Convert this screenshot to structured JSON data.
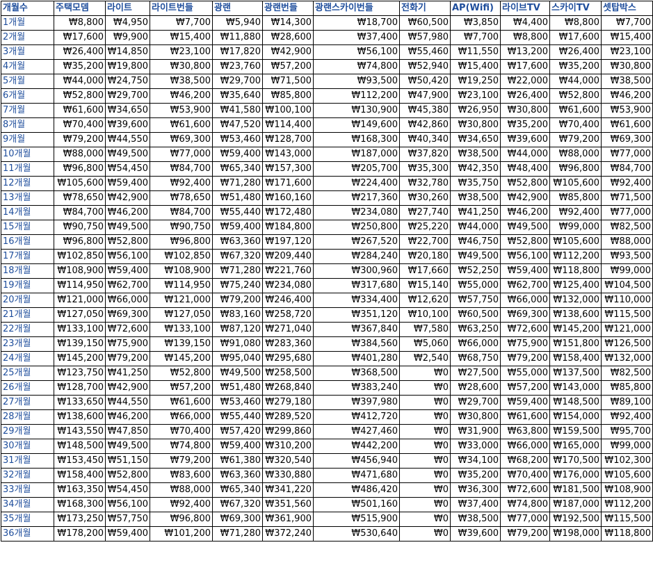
{
  "headers": [
    "개월수",
    "주택모뎀",
    "라이트",
    "라이트번들",
    "광랜",
    "광랜번들",
    "광랜스카이번들",
    "전화기",
    "AP(Wifi)",
    "라이브TV",
    "스카이TV",
    "셋탑박스"
  ],
  "rows": [
    [
      "1개월",
      "₩8,800",
      "₩4,950",
      "₩7,700",
      "₩5,940",
      "₩14,300",
      "₩18,700",
      "₩60,500",
      "₩3,850",
      "₩4,400",
      "₩8,800",
      "₩7,700"
    ],
    [
      "2개월",
      "₩17,600",
      "₩9,900",
      "₩15,400",
      "₩11,880",
      "₩28,600",
      "₩37,400",
      "₩57,980",
      "₩7,700",
      "₩8,800",
      "₩17,600",
      "₩15,400"
    ],
    [
      "3개월",
      "₩26,400",
      "₩14,850",
      "₩23,100",
      "₩17,820",
      "₩42,900",
      "₩56,100",
      "₩55,460",
      "₩11,550",
      "₩13,200",
      "₩26,400",
      "₩23,100"
    ],
    [
      "4개월",
      "₩35,200",
      "₩19,800",
      "₩30,800",
      "₩23,760",
      "₩57,200",
      "₩74,800",
      "₩52,940",
      "₩15,400",
      "₩17,600",
      "₩35,200",
      "₩30,800"
    ],
    [
      "5개월",
      "₩44,000",
      "₩24,750",
      "₩38,500",
      "₩29,700",
      "₩71,500",
      "₩93,500",
      "₩50,420",
      "₩19,250",
      "₩22,000",
      "₩44,000",
      "₩38,500"
    ],
    [
      "6개월",
      "₩52,800",
      "₩29,700",
      "₩46,200",
      "₩35,640",
      "₩85,800",
      "₩112,200",
      "₩47,900",
      "₩23,100",
      "₩26,400",
      "₩52,800",
      "₩46,200"
    ],
    [
      "7개월",
      "₩61,600",
      "₩34,650",
      "₩53,900",
      "₩41,580",
      "₩100,100",
      "₩130,900",
      "₩45,380",
      "₩26,950",
      "₩30,800",
      "₩61,600",
      "₩53,900"
    ],
    [
      "8개월",
      "₩70,400",
      "₩39,600",
      "₩61,600",
      "₩47,520",
      "₩114,400",
      "₩149,600",
      "₩42,860",
      "₩30,800",
      "₩35,200",
      "₩70,400",
      "₩61,600"
    ],
    [
      "9개월",
      "₩79,200",
      "₩44,550",
      "₩69,300",
      "₩53,460",
      "₩128,700",
      "₩168,300",
      "₩40,340",
      "₩34,650",
      "₩39,600",
      "₩79,200",
      "₩69,300"
    ],
    [
      "10개월",
      "₩88,000",
      "₩49,500",
      "₩77,000",
      "₩59,400",
      "₩143,000",
      "₩187,000",
      "₩37,820",
      "₩38,500",
      "₩44,000",
      "₩88,000",
      "₩77,000"
    ],
    [
      "11개월",
      "₩96,800",
      "₩54,450",
      "₩84,700",
      "₩65,340",
      "₩157,300",
      "₩205,700",
      "₩35,300",
      "₩42,350",
      "₩48,400",
      "₩96,800",
      "₩84,700"
    ],
    [
      "12개월",
      "₩105,600",
      "₩59,400",
      "₩92,400",
      "₩71,280",
      "₩171,600",
      "₩224,400",
      "₩32,780",
      "₩35,750",
      "₩52,800",
      "₩105,600",
      "₩92,400"
    ],
    [
      "13개월",
      "₩78,650",
      "₩42,900",
      "₩78,650",
      "₩51,480",
      "₩160,160",
      "₩217,360",
      "₩30,260",
      "₩38,500",
      "₩42,900",
      "₩85,800",
      "₩71,500"
    ],
    [
      "14개월",
      "₩84,700",
      "₩46,200",
      "₩84,700",
      "₩55,440",
      "₩172,480",
      "₩234,080",
      "₩27,740",
      "₩41,250",
      "₩46,200",
      "₩92,400",
      "₩77,000"
    ],
    [
      "15개월",
      "₩90,750",
      "₩49,500",
      "₩90,750",
      "₩59,400",
      "₩184,800",
      "₩250,800",
      "₩25,220",
      "₩44,000",
      "₩49,500",
      "₩99,000",
      "₩82,500"
    ],
    [
      "16개월",
      "₩96,800",
      "₩52,800",
      "₩96,800",
      "₩63,360",
      "₩197,120",
      "₩267,520",
      "₩22,700",
      "₩46,750",
      "₩52,800",
      "₩105,600",
      "₩88,000"
    ],
    [
      "17개월",
      "₩102,850",
      "₩56,100",
      "₩102,850",
      "₩67,320",
      "₩209,440",
      "₩284,240",
      "₩20,180",
      "₩49,500",
      "₩56,100",
      "₩112,200",
      "₩93,500"
    ],
    [
      "18개월",
      "₩108,900",
      "₩59,400",
      "₩108,900",
      "₩71,280",
      "₩221,760",
      "₩300,960",
      "₩17,660",
      "₩52,250",
      "₩59,400",
      "₩118,800",
      "₩99,000"
    ],
    [
      "19개월",
      "₩114,950",
      "₩62,700",
      "₩114,950",
      "₩75,240",
      "₩234,080",
      "₩317,680",
      "₩15,140",
      "₩55,000",
      "₩62,700",
      "₩125,400",
      "₩104,500"
    ],
    [
      "20개월",
      "₩121,000",
      "₩66,000",
      "₩121,000",
      "₩79,200",
      "₩246,400",
      "₩334,400",
      "₩12,620",
      "₩57,750",
      "₩66,000",
      "₩132,000",
      "₩110,000"
    ],
    [
      "21개월",
      "₩127,050",
      "₩69,300",
      "₩127,050",
      "₩83,160",
      "₩258,720",
      "₩351,120",
      "₩10,100",
      "₩60,500",
      "₩69,300",
      "₩138,600",
      "₩115,500"
    ],
    [
      "22개월",
      "₩133,100",
      "₩72,600",
      "₩133,100",
      "₩87,120",
      "₩271,040",
      "₩367,840",
      "₩7,580",
      "₩63,250",
      "₩72,600",
      "₩145,200",
      "₩121,000"
    ],
    [
      "23개월",
      "₩139,150",
      "₩75,900",
      "₩139,150",
      "₩91,080",
      "₩283,360",
      "₩384,560",
      "₩5,060",
      "₩66,000",
      "₩75,900",
      "₩151,800",
      "₩126,500"
    ],
    [
      "24개월",
      "₩145,200",
      "₩79,200",
      "₩145,200",
      "₩95,040",
      "₩295,680",
      "₩401,280",
      "₩2,540",
      "₩68,750",
      "₩79,200",
      "₩158,400",
      "₩132,000"
    ],
    [
      "25개월",
      "₩123,750",
      "₩41,250",
      "₩52,800",
      "₩49,500",
      "₩258,500",
      "₩368,500",
      "₩0",
      "₩27,500",
      "₩55,000",
      "₩137,500",
      "₩82,500"
    ],
    [
      "26개월",
      "₩128,700",
      "₩42,900",
      "₩57,200",
      "₩51,480",
      "₩268,840",
      "₩383,240",
      "₩0",
      "₩28,600",
      "₩57,200",
      "₩143,000",
      "₩85,800"
    ],
    [
      "27개월",
      "₩133,650",
      "₩44,550",
      "₩61,600",
      "₩53,460",
      "₩279,180",
      "₩397,980",
      "₩0",
      "₩29,700",
      "₩59,400",
      "₩148,500",
      "₩89,100"
    ],
    [
      "28개월",
      "₩138,600",
      "₩46,200",
      "₩66,000",
      "₩55,440",
      "₩289,520",
      "₩412,720",
      "₩0",
      "₩30,800",
      "₩61,600",
      "₩154,000",
      "₩92,400"
    ],
    [
      "29개월",
      "₩143,550",
      "₩47,850",
      "₩70,400",
      "₩57,420",
      "₩299,860",
      "₩427,460",
      "₩0",
      "₩31,900",
      "₩63,800",
      "₩159,500",
      "₩95,700"
    ],
    [
      "30개월",
      "₩148,500",
      "₩49,500",
      "₩74,800",
      "₩59,400",
      "₩310,200",
      "₩442,200",
      "₩0",
      "₩33,000",
      "₩66,000",
      "₩165,000",
      "₩99,000"
    ],
    [
      "31개월",
      "₩153,450",
      "₩51,150",
      "₩79,200",
      "₩61,380",
      "₩320,540",
      "₩456,940",
      "₩0",
      "₩34,100",
      "₩68,200",
      "₩170,500",
      "₩102,300"
    ],
    [
      "32개월",
      "₩158,400",
      "₩52,800",
      "₩83,600",
      "₩63,360",
      "₩330,880",
      "₩471,680",
      "₩0",
      "₩35,200",
      "₩70,400",
      "₩176,000",
      "₩105,600"
    ],
    [
      "33개월",
      "₩163,350",
      "₩54,450",
      "₩88,000",
      "₩65,340",
      "₩341,220",
      "₩486,420",
      "₩0",
      "₩36,300",
      "₩72,600",
      "₩181,500",
      "₩108,900"
    ],
    [
      "34개월",
      "₩168,300",
      "₩56,100",
      "₩92,400",
      "₩67,320",
      "₩351,560",
      "₩501,160",
      "₩0",
      "₩37,400",
      "₩74,800",
      "₩187,000",
      "₩112,200"
    ],
    [
      "35개월",
      "₩173,250",
      "₩57,750",
      "₩96,800",
      "₩69,300",
      "₩361,900",
      "₩515,900",
      "₩0",
      "₩38,500",
      "₩77,000",
      "₩192,500",
      "₩115,500"
    ],
    [
      "36개월",
      "₩178,200",
      "₩59,400",
      "₩101,200",
      "₩71,280",
      "₩372,240",
      "₩530,640",
      "₩0",
      "₩39,600",
      "₩79,200",
      "₩198,000",
      "₩118,800"
    ]
  ],
  "colors": {
    "header_text": "#1f4e9c",
    "label_text": "#1f4e9c",
    "value_text": "#000000",
    "border": "#000000"
  }
}
